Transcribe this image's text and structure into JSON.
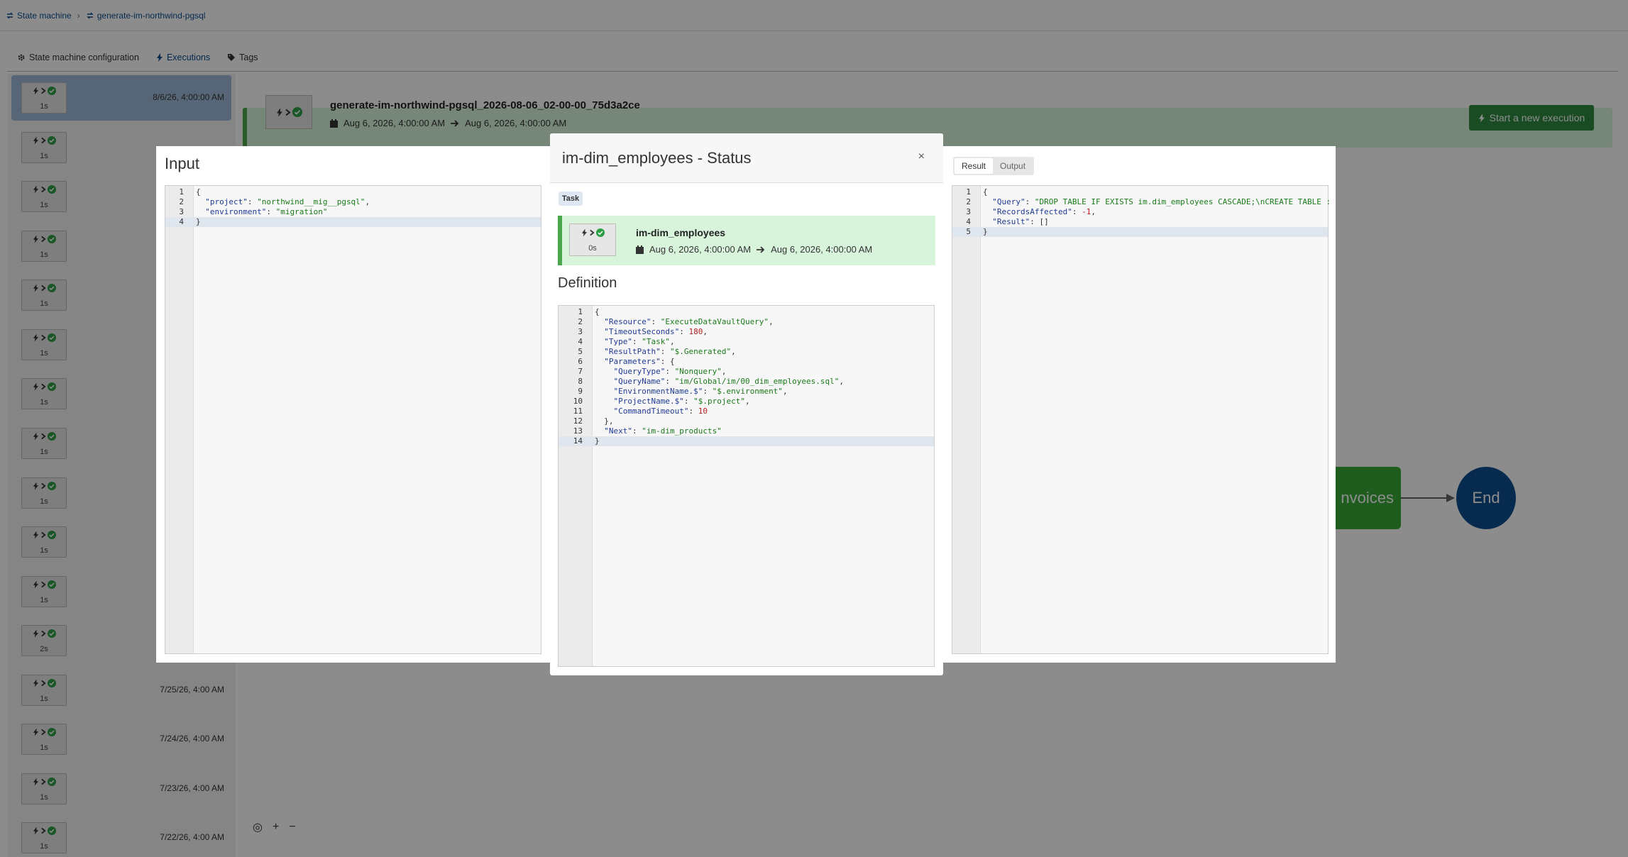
{
  "breadcrumb": {
    "root": "State machine",
    "current": "generate-im-northwind-pgsql",
    "separator": "›"
  },
  "tabs": [
    {
      "label": "State machine configuration",
      "icon": "gear-icon"
    },
    {
      "label": "Executions",
      "icon": "bolt-icon"
    },
    {
      "label": "Tags",
      "icon": "tag-icon"
    }
  ],
  "executions": [
    {
      "duration": "1s",
      "date": "8/6/26, 4:00:00 AM"
    },
    {
      "duration": "1s",
      "date": ""
    },
    {
      "duration": "1s",
      "date": ""
    },
    {
      "duration": "1s",
      "date": ""
    },
    {
      "duration": "1s",
      "date": ""
    },
    {
      "duration": "1s",
      "date": ""
    },
    {
      "duration": "1s",
      "date": ""
    },
    {
      "duration": "1s",
      "date": ""
    },
    {
      "duration": "1s",
      "date": ""
    },
    {
      "duration": "1s",
      "date": ""
    },
    {
      "duration": "1s",
      "date": ""
    },
    {
      "duration": "2s",
      "date": ""
    },
    {
      "duration": "1s",
      "date": "7/25/26, 4:00 AM"
    },
    {
      "duration": "1s",
      "date": "7/24/26, 4:00 AM"
    },
    {
      "duration": "1s",
      "date": "7/23/26, 4:00 AM"
    },
    {
      "duration": "1s",
      "date": "7/22/26, 4:00 AM"
    }
  ],
  "execution_header": {
    "name": "generate-im-northwind-pgsql_2026-08-06_02-00-00_75d3a2ce",
    "start": "Aug 6, 2026, 4:00:00 AM",
    "end": "Aug 6, 2026, 4:00:00 AM",
    "start_button": "Start a new execution"
  },
  "graph": {
    "node_partial_label": "nvoices",
    "end_label": "End"
  },
  "zoom": {
    "fit": "◎",
    "in": "+",
    "out": "−"
  },
  "input_panel": {
    "title": "Input",
    "lines": [
      [
        [
          "p",
          "{"
        ]
      ],
      [
        [
          "p",
          "  "
        ],
        [
          "k",
          "\"project\""
        ],
        [
          "p",
          ": "
        ],
        [
          "s",
          "\"northwind__mig__pgsql\""
        ],
        [
          "p",
          ","
        ]
      ],
      [
        [
          "p",
          "  "
        ],
        [
          "k",
          "\"environment\""
        ],
        [
          "p",
          ": "
        ],
        [
          "s",
          "\"migration\""
        ]
      ],
      [
        [
          "p",
          "}"
        ]
      ]
    ],
    "current_line": 4
  },
  "modal": {
    "title": "im-dim_employees - Status",
    "close": "×",
    "tag": "Task",
    "state_name": "im-dim_employees",
    "state_duration": "0s",
    "state_start": "Aug 6, 2026, 4:00:00 AM",
    "state_end": "Aug 6, 2026, 4:00:00 AM",
    "definition_title": "Definition",
    "definition_lines": [
      [
        [
          "p",
          "{"
        ]
      ],
      [
        [
          "p",
          "  "
        ],
        [
          "k",
          "\"Resource\""
        ],
        [
          "p",
          ": "
        ],
        [
          "s",
          "\"ExecuteDataVaultQuery\""
        ],
        [
          "p",
          ","
        ]
      ],
      [
        [
          "p",
          "  "
        ],
        [
          "k",
          "\"TimeoutSeconds\""
        ],
        [
          "p",
          ": "
        ],
        [
          "n",
          "180"
        ],
        [
          "p",
          ","
        ]
      ],
      [
        [
          "p",
          "  "
        ],
        [
          "k",
          "\"Type\""
        ],
        [
          "p",
          ": "
        ],
        [
          "s",
          "\"Task\""
        ],
        [
          "p",
          ","
        ]
      ],
      [
        [
          "p",
          "  "
        ],
        [
          "k",
          "\"ResultPath\""
        ],
        [
          "p",
          ": "
        ],
        [
          "s",
          "\"$.Generated\""
        ],
        [
          "p",
          ","
        ]
      ],
      [
        [
          "p",
          "  "
        ],
        [
          "k",
          "\"Parameters\""
        ],
        [
          "p",
          ": {"
        ]
      ],
      [
        [
          "p",
          "    "
        ],
        [
          "k",
          "\"QueryType\""
        ],
        [
          "p",
          ": "
        ],
        [
          "s",
          "\"Nonquery\""
        ],
        [
          "p",
          ","
        ]
      ],
      [
        [
          "p",
          "    "
        ],
        [
          "k",
          "\"QueryName\""
        ],
        [
          "p",
          ": "
        ],
        [
          "s",
          "\"im/Global/im/00_dim_employees.sql\""
        ],
        [
          "p",
          ","
        ]
      ],
      [
        [
          "p",
          "    "
        ],
        [
          "k",
          "\"EnvironmentName.$\""
        ],
        [
          "p",
          ": "
        ],
        [
          "s",
          "\"$.environment\""
        ],
        [
          "p",
          ","
        ]
      ],
      [
        [
          "p",
          "    "
        ],
        [
          "k",
          "\"ProjectName.$\""
        ],
        [
          "p",
          ": "
        ],
        [
          "s",
          "\"$.project\""
        ],
        [
          "p",
          ","
        ]
      ],
      [
        [
          "p",
          "    "
        ],
        [
          "k",
          "\"CommandTimeout\""
        ],
        [
          "p",
          ": "
        ],
        [
          "n",
          "10"
        ]
      ],
      [
        [
          "p",
          "  },"
        ]
      ],
      [
        [
          "p",
          "  "
        ],
        [
          "k",
          "\"Next\""
        ],
        [
          "p",
          ": "
        ],
        [
          "s",
          "\"im-dim_products\""
        ]
      ],
      [
        [
          "p",
          "}"
        ]
      ]
    ],
    "definition_current_line": 14
  },
  "result_panel": {
    "tabs": [
      {
        "label": "Result",
        "active": true
      },
      {
        "label": "Output",
        "active": false
      }
    ],
    "lines": [
      [
        [
          "p",
          "{"
        ]
      ],
      [
        [
          "p",
          "  "
        ],
        [
          "k",
          "\"Query\""
        ],
        [
          "p",
          ": "
        ],
        [
          "s",
          "\"DROP TABLE IF EXISTS im.dim_employees CASCADE;\\nCREATE TABLE :"
        ]
      ],
      [
        [
          "p",
          "  "
        ],
        [
          "k",
          "\"RecordsAffected\""
        ],
        [
          "p",
          ": "
        ],
        [
          "n",
          "-1"
        ],
        [
          "p",
          ","
        ]
      ],
      [
        [
          "p",
          "  "
        ],
        [
          "k",
          "\"Result\""
        ],
        [
          "p",
          ": []"
        ]
      ],
      [
        [
          "p",
          "}"
        ]
      ]
    ],
    "current_line": 5
  },
  "colors": {
    "accent": "#0b4f8f",
    "success": "#2e9e45",
    "card_bg": "#d8f5dc",
    "card_border": "#4aa64a"
  }
}
